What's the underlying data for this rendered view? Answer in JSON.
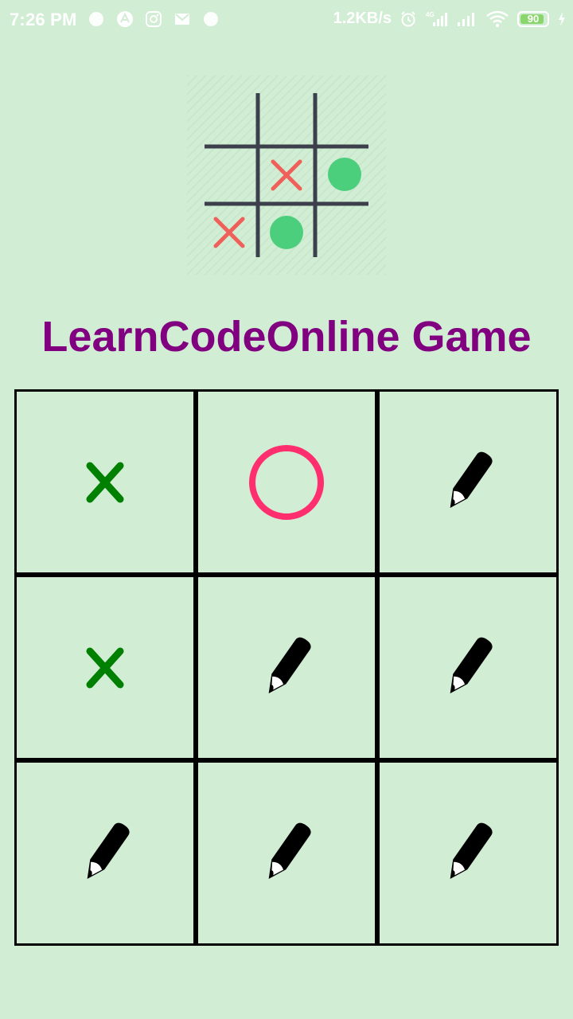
{
  "status_bar": {
    "time": "7:26 PM",
    "net_speed": "1.2KB/s",
    "battery_level": "90",
    "network_type": "4G",
    "icons_left": [
      "circle-app-icon",
      "arrow-app-icon",
      "instagram-icon",
      "mail-icon",
      "circle-app-icon"
    ],
    "icons_right": [
      "alarm-icon",
      "signal-4g-icon",
      "signal-icon",
      "wifi-icon",
      "battery-icon",
      "charging-icon"
    ]
  },
  "logo": {
    "icon": "tic-tac-toe-logo",
    "x_color": "#f0605a",
    "o_color": "#4ccf7c",
    "grid_color": "#3c3f4c"
  },
  "title": "LearnCodeOnline Game",
  "colors": {
    "background": "#d1edd4",
    "title": "#800080",
    "x_mark": "#008000",
    "o_mark": "#ff2e6e",
    "grid": "#000000"
  },
  "board": {
    "cells": [
      "X",
      "O",
      "empty",
      "X",
      "empty",
      "empty",
      "empty",
      "empty",
      "empty"
    ],
    "empty_icon": "pencil-icon",
    "x_icon": "cross-icon",
    "o_icon": "circle-icon"
  }
}
